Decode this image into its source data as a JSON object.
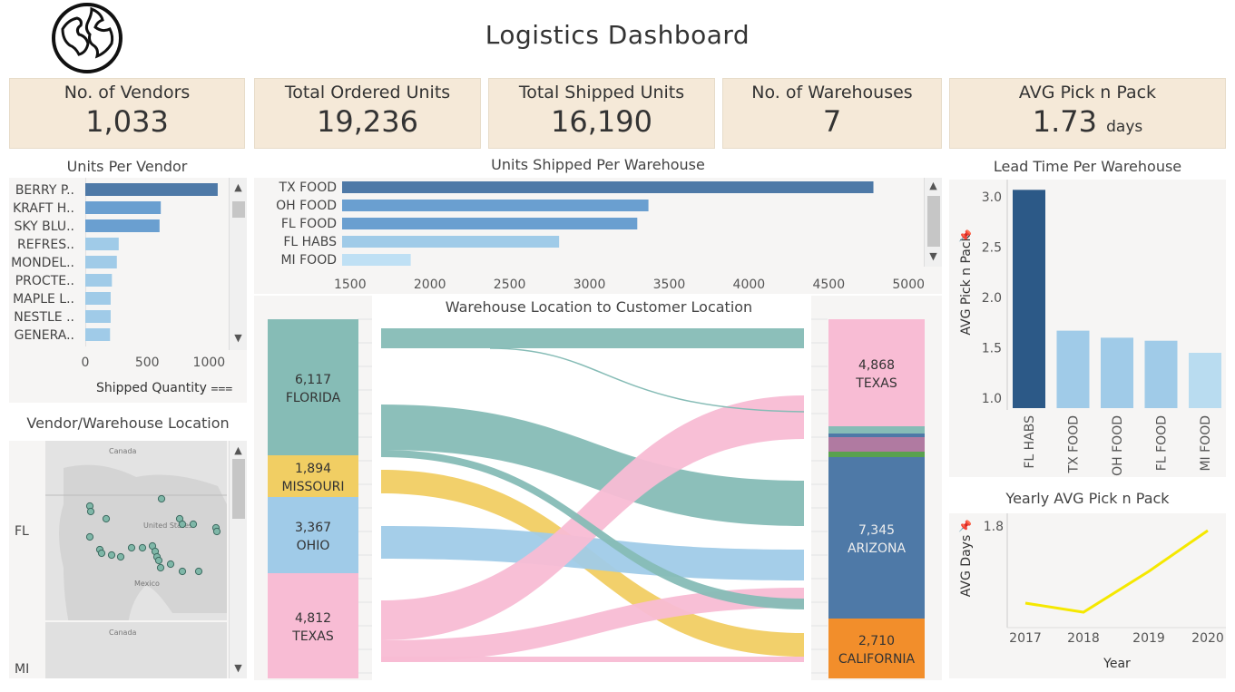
{
  "header": {
    "title": "Logistics Dashboard",
    "logo_icon": "globe-icon"
  },
  "kpis": [
    {
      "label": "No. of Vendors",
      "value": "1,033",
      "unit": ""
    },
    {
      "label": "Total Ordered Units",
      "value": "19,236",
      "unit": ""
    },
    {
      "label": "Total Shipped Units",
      "value": "16,190",
      "unit": ""
    },
    {
      "label": "No. of Warehouses",
      "value": "7",
      "unit": ""
    },
    {
      "label": "AVG Pick n Pack",
      "value": "1.73",
      "unit": "days"
    }
  ],
  "units_per_vendor": {
    "title": "Units Per Vendor",
    "axis_label": "Shipped Quantity",
    "sort_icon": "sort-descending-icon",
    "chart_data": {
      "type": "bar",
      "categories": [
        "BERRY P..",
        "KRAFT H..",
        "SKY BLU..",
        "REFRES..",
        "MONDEL..",
        "PROCTE..",
        "MAPLE L..",
        "NESTLE ..",
        "GENERA.."
      ],
      "values": [
        1070,
        610,
        600,
        270,
        255,
        215,
        205,
        205,
        200
      ],
      "ticks": [
        "0",
        "500",
        "1000"
      ],
      "xlim": [
        0,
        1100
      ]
    }
  },
  "units_per_warehouse": {
    "title": "Units Shipped Per Warehouse",
    "chart_data": {
      "type": "bar",
      "categories": [
        "TX FOOD",
        "OH FOOD",
        "FL FOOD",
        "FL HABS",
        "MI FOOD"
      ],
      "values": [
        4780,
        3370,
        3300,
        2810,
        1880
      ],
      "ticks": [
        "1500",
        "2000",
        "2500",
        "3000",
        "3500",
        "4000",
        "4500",
        "5000"
      ],
      "xlim": [
        1450,
        5050
      ]
    }
  },
  "lead_time": {
    "title": "Lead Time Per Warehouse",
    "ylabel": "AVG Pick n Pack",
    "pin_icon": "pin-icon",
    "chart_data": {
      "type": "bar",
      "categories": [
        "FL HABS",
        "TX FOOD",
        "OH FOOD",
        "FL FOOD",
        "MI FOOD"
      ],
      "values": [
        3.07,
        1.67,
        1.6,
        1.57,
        1.45
      ],
      "ticks": [
        "3.0",
        "2.5",
        "2.0",
        "1.5",
        "1.0"
      ],
      "ylim": [
        0.9,
        3.1
      ]
    }
  },
  "yearly_pick": {
    "title": "Yearly AVG Pick n Pack",
    "ylabel": "AVG Days",
    "xlabel": "Year",
    "pin_icon": "pin-icon",
    "chart_data": {
      "type": "line",
      "x": [
        "2017",
        "2018",
        "2019",
        "2020"
      ],
      "values": [
        1.63,
        1.61,
        1.7,
        1.79
      ],
      "ytick": "1.8",
      "ylim": [
        1.58,
        1.82
      ]
    }
  },
  "vendor_map": {
    "title": "Vendor/Warehouse Location",
    "rows": [
      "FL",
      "MI"
    ],
    "map_labels": [
      "Canada",
      "United States",
      "Mexico",
      "Canada"
    ]
  },
  "sankey": {
    "title": "Warehouse Location to Customer Location",
    "left_nodes": [
      {
        "value": "6,117",
        "name": "FLORIDA",
        "color": "#86bcb6"
      },
      {
        "value": "1,894",
        "name": "MISSOURI",
        "color": "#f1ce63"
      },
      {
        "value": "3,367",
        "name": "OHIO",
        "color": "#a0cbe8"
      },
      {
        "value": "4,812",
        "name": "TEXAS",
        "color": "#f8bcd4"
      }
    ],
    "right_nodes": [
      {
        "value": "4,868",
        "name": "TEXAS",
        "color": "#f8bcd4"
      },
      {
        "value": "7,345",
        "name": "ARIZONA",
        "color": "#4e79a7"
      },
      {
        "value": "2,710",
        "name": "CALIFORNIA",
        "color": "#f28e2b"
      }
    ]
  }
}
